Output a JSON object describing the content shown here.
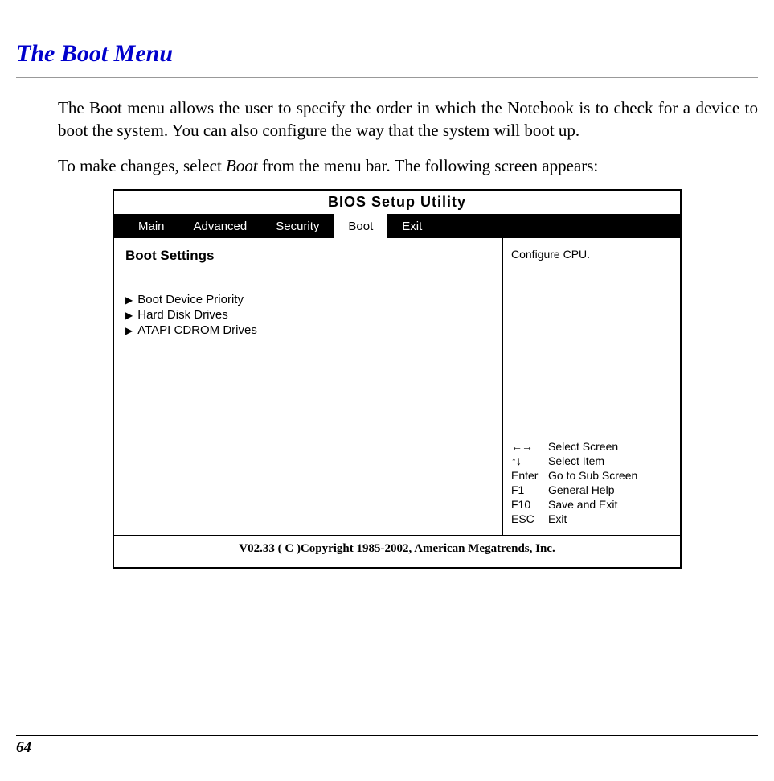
{
  "title": "The Boot Menu",
  "paragraph1": "The Boot menu allows the user to specify the order in which the Notebook is to check for a device to boot the system.  You can also configure the way that the system will boot up.",
  "paragraph2_a": "To make changes, select ",
  "paragraph2_italic": "Boot",
  "paragraph2_b": " from the menu bar.  The following screen appears:",
  "page_number": "64",
  "bios": {
    "window_title": "BIOS  Setup  Utility",
    "tabs": [
      "Main",
      "Advanced",
      "Security",
      "Boot",
      "Exit"
    ],
    "active_tab_index": 3,
    "heading": "Boot Settings",
    "items": [
      "Boot Device Priority",
      "Hard Disk Drives",
      "ATAPI CDROM Drives"
    ],
    "help_top": "Configure CPU.",
    "help_rows": [
      {
        "key_glyph": "↔",
        "key_text": "",
        "desc": "Select Screen"
      },
      {
        "key_glyph": "↕",
        "key_text": "",
        "desc": "Select Item"
      },
      {
        "key_glyph": "",
        "key_text": "Enter",
        "desc": "Go to Sub Screen"
      },
      {
        "key_glyph": "",
        "key_text": "F1",
        "desc": "General Help"
      },
      {
        "key_glyph": "",
        "key_text": "F10",
        "desc": "Save and Exit"
      },
      {
        "key_glyph": "",
        "key_text": "ESC",
        "desc": "Exit"
      }
    ],
    "footer": "V02.33 ( C )Copyright 1985-2002, American Megatrends, Inc."
  }
}
